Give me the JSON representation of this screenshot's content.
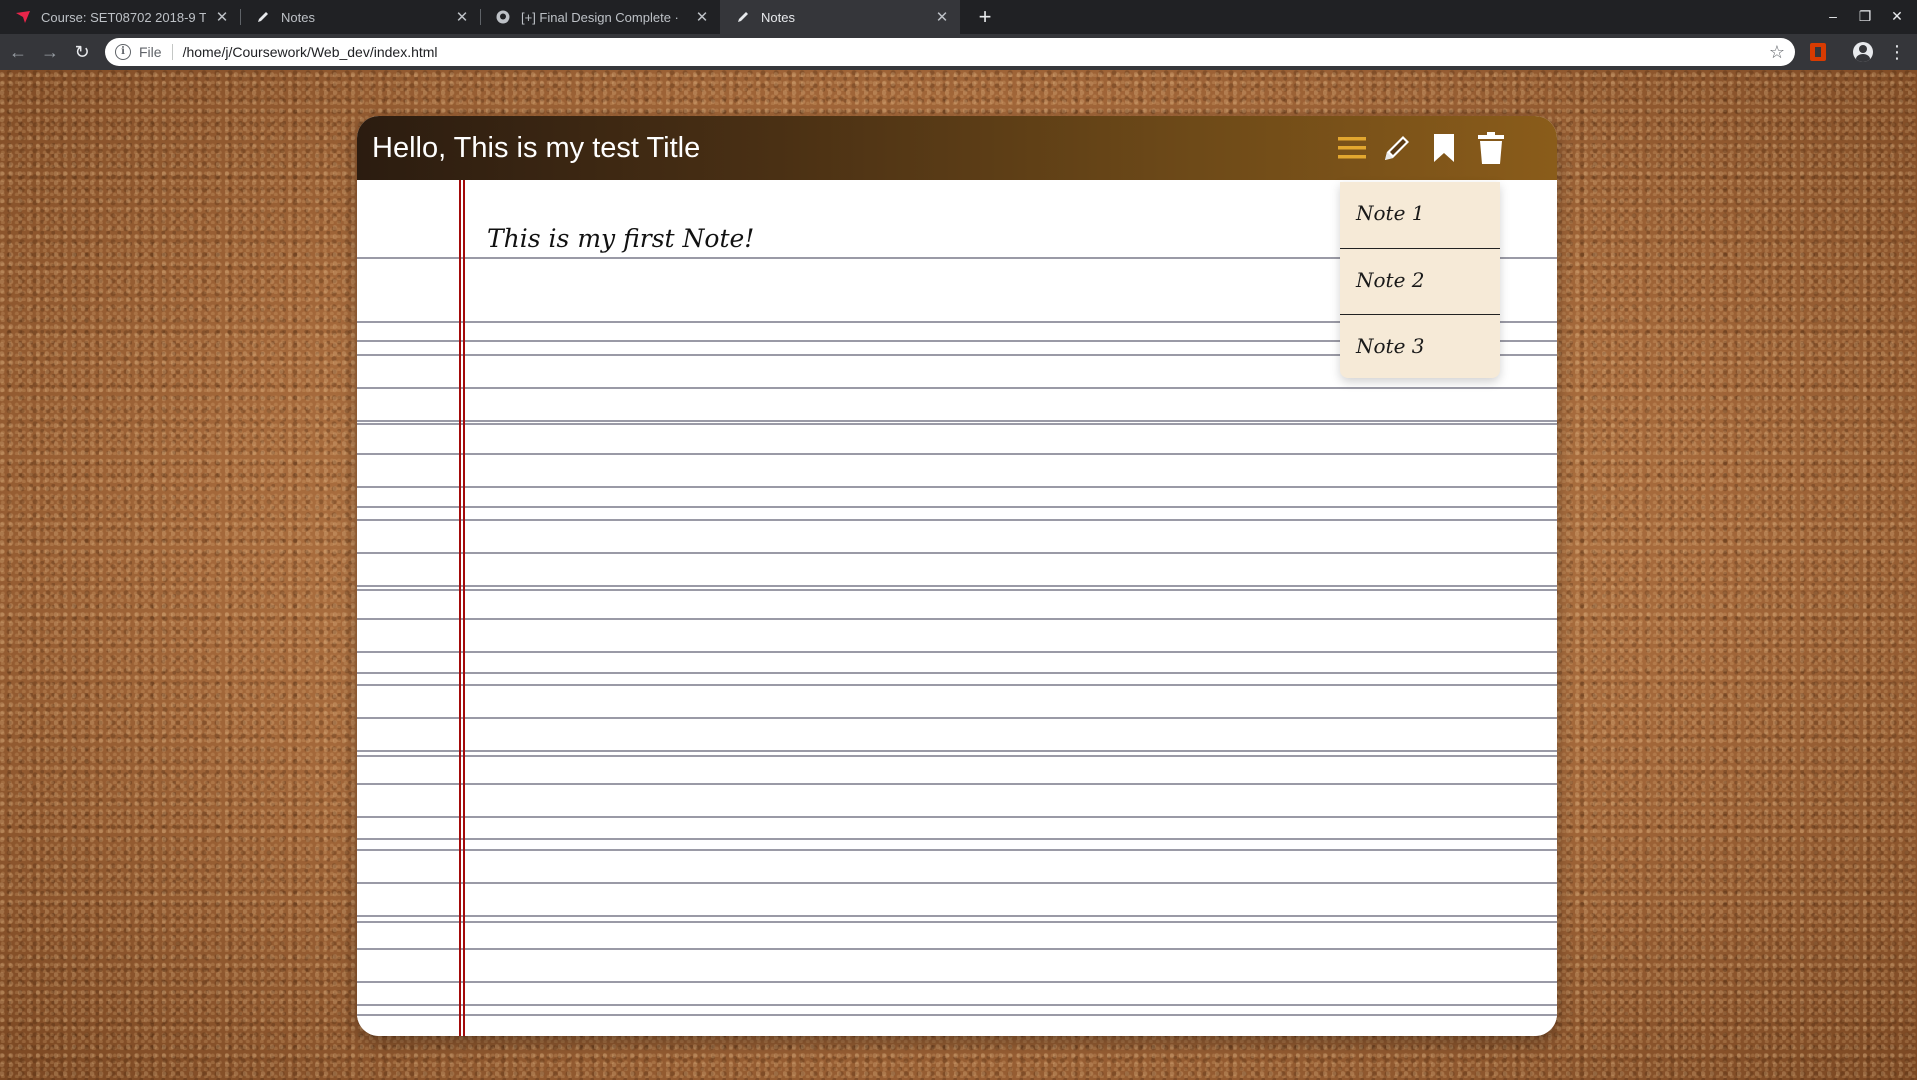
{
  "browser": {
    "tabs": [
      {
        "label": "Course: SET08702 2018-9 T",
        "favicon": "moodle-icon",
        "active": false
      },
      {
        "label": "Notes",
        "favicon": "notes-pen-icon",
        "active": false
      },
      {
        "label": "[+] Final Design Complete ·",
        "favicon": "github-icon",
        "active": false
      },
      {
        "label": "Notes",
        "favicon": "notes-pen-icon",
        "active": true
      }
    ],
    "address": {
      "scheme": "File",
      "url": "/home/j/Coursework/Web_dev/index.html"
    }
  },
  "note": {
    "title": "Hello, This is my test Title",
    "body": "This is my first Note!",
    "toolbar_icons": [
      "menu-icon",
      "pencil-icon",
      "bookmark-icon",
      "trash-icon"
    ],
    "dropdown_items": [
      {
        "label": "Note 1"
      },
      {
        "label": "Note 2"
      },
      {
        "label": "Note 3"
      }
    ]
  },
  "colors": {
    "header_dark": "#2b1c10",
    "header_light": "#8a5c1a",
    "menu_icon": "#e3a72f",
    "margin_line": "#a30a0a",
    "dropdown_bg": "#f6ead7",
    "cork": "#a5693a"
  }
}
